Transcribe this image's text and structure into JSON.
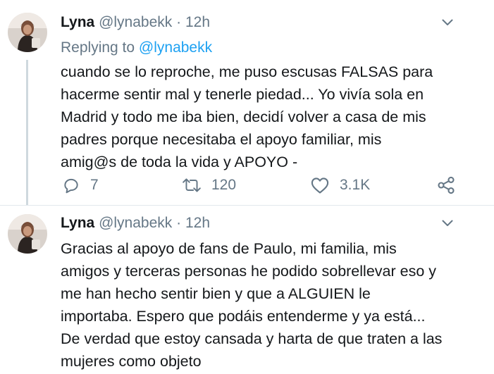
{
  "tweets": [
    {
      "author_name": "Lyna",
      "handle": "@lynabekk",
      "separator": "·",
      "time": "12h",
      "replying_label": "Replying to",
      "replying_handle": "@lynabekk",
      "lines": [
        "cuando se lo reproche, me puso escusas FALSAS para",
        "hacerme sentir mal y tenerle piedad... Yo vivía sola en",
        "Madrid y todo me iba bien, decidí volver a casa de mis",
        "padres porque necesitaba el apoyo familiar, mis",
        "amig@s de toda la vida y APOYO -"
      ],
      "actions": {
        "reply_icon": "reply-icon",
        "reply_count": "7",
        "retweet_icon": "retweet-icon",
        "retweet_count": "120",
        "like_icon": "heart-icon",
        "like_count": "3.1K",
        "share_icon": "share-icon"
      }
    },
    {
      "author_name": "Lyna",
      "handle": "@lynabekk",
      "separator": "·",
      "time": "12h",
      "lines": [
        "Gracias al apoyo de fans de Paulo, mi familia, mis",
        "amigos y terceras personas he podido sobrellevar eso y",
        "me han hecho sentir bien y que a ALGUIEN le",
        "importaba. Espero que podáis entenderme y ya está...",
        "De verdad que estoy cansada y harta de que traten a las",
        "mujeres como objeto"
      ]
    }
  ],
  "colors": {
    "text": "#14171a",
    "secondary": "#657786",
    "link": "#1da1f2",
    "divider": "#e1e8ed",
    "thread_line": "#cfd9de"
  }
}
